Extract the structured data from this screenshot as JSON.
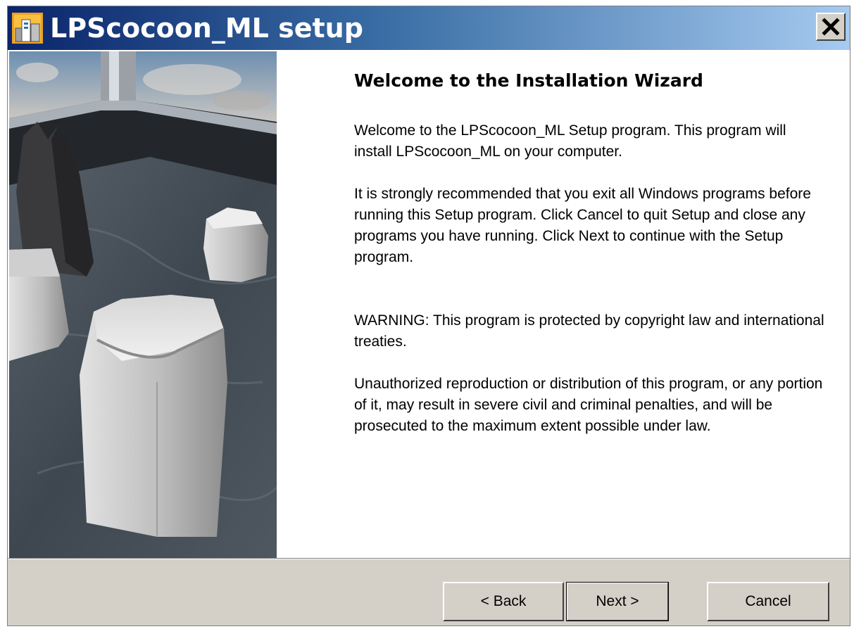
{
  "window": {
    "title": "LPScocoon_ML setup",
    "title_bar_gradient": [
      "#0a246a",
      "#3a6ea5",
      "#a6caf0"
    ],
    "close_icon": "close-icon"
  },
  "wizard": {
    "heading": "Welcome to the Installation Wizard",
    "paragraphs": [
      "Welcome to the LPScocoon_ML Setup program. This program will install LPScocoon_ML on your computer.",
      "It is strongly recommended that you exit all Windows programs before running this Setup program. Click Cancel to quit Setup and close any programs you have running. Click Next to continue with the Setup program.",
      "WARNING: This program is protected by copyright law and international treaties.",
      "Unauthorized reproduction or distribution of this program, or any portion of it, may result in severe civil and criminal penalties, and will be prosecuted to the maximum extent possible under law."
    ]
  },
  "buttons": {
    "back": "< Back",
    "next": "Next >",
    "cancel": "Cancel"
  }
}
